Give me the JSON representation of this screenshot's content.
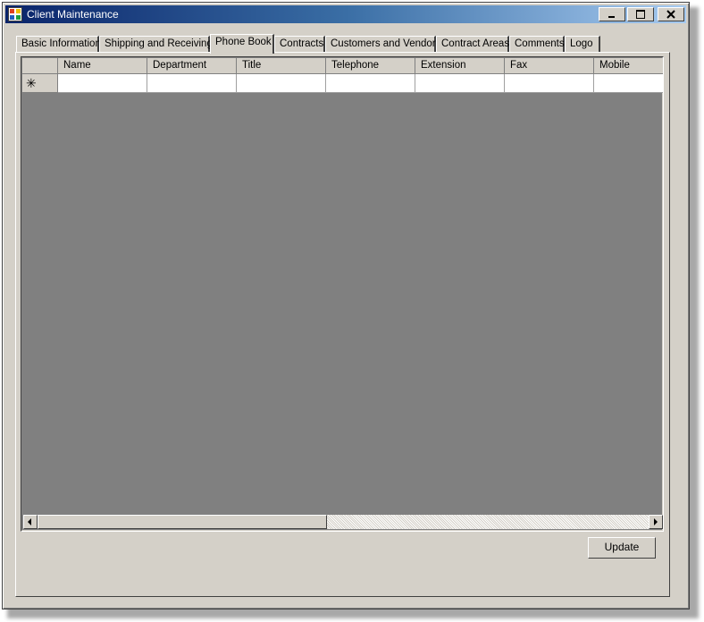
{
  "window": {
    "title": "Client Maintenance"
  },
  "tabs": [
    {
      "label": "Basic Information"
    },
    {
      "label": "Shipping and Receiving"
    },
    {
      "label": "Phone Book"
    },
    {
      "label": "Contracts"
    },
    {
      "label": "Customers and Vendors"
    },
    {
      "label": "Contract Areas"
    },
    {
      "label": "Comments"
    },
    {
      "label": "Logo"
    }
  ],
  "active_tab": "Phone Book",
  "grid": {
    "columns": [
      "Name",
      "Department",
      "Title",
      "Telephone",
      "Extension",
      "Fax",
      "Mobile"
    ],
    "new_row_marker": "✳"
  },
  "buttons": {
    "update": "Update"
  },
  "icons": {
    "app": "app-icon",
    "minimize": "minimize-icon",
    "maximize": "maximize-icon",
    "close": "close-icon",
    "scroll_left": "arrow-left-icon",
    "scroll_right": "arrow-right-icon"
  },
  "colors": {
    "titlebar_start": "#0a246a",
    "titlebar_end": "#a6caf0",
    "face": "#d4d0c8",
    "grid_bg": "#808080"
  }
}
